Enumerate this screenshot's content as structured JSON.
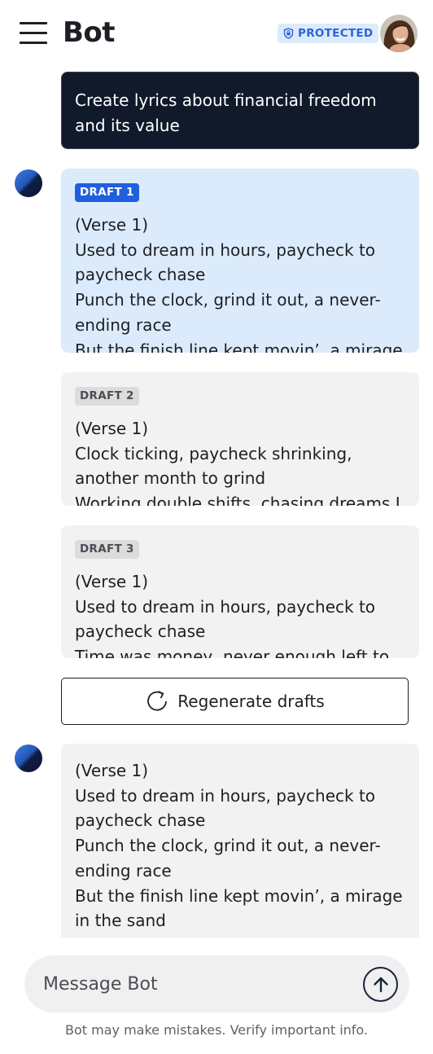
{
  "header": {
    "title": "Bot",
    "badge": "PROTECTED"
  },
  "user_message": "Create lyrics about financial freedom and its value",
  "drafts": [
    {
      "label": "DRAFT 1",
      "text": "(Verse 1)\nUsed to dream in hours, paycheck to paycheck chase\nPunch the clock, grind it out, a never-ending race\nBut the finish line kept movin’, a mirage in",
      "selected": true
    },
    {
      "label": "DRAFT 2",
      "text": "(Verse 1)\nClock ticking, paycheck shrinking, another month to grind\nWorking double shifts, chasing dreams I",
      "selected": false
    },
    {
      "label": "DRAFT 3",
      "text": "(Verse 1)\nUsed to dream in hours, paycheck to paycheck chase\nTime was money, never enough left to",
      "selected": false
    }
  ],
  "regenerate_label": "Regenerate drafts",
  "reply_text": "(Verse 1)\nUsed to dream in hours, paycheck to paycheck chase\nPunch the clock, grind it out, a never-ending race\nBut the finish line kept movin’, a mirage in the sand",
  "composer": {
    "placeholder": "Message Bot"
  },
  "disclaimer": "Bot may make mistakes. Verify important info.",
  "icons": {
    "menu": "hamburger-menu-icon",
    "shield": "shield-icon",
    "regenerate": "refresh-icon",
    "send": "arrow-up-icon"
  },
  "colors": {
    "accent": "#1f5fe0",
    "user_bubble": "#111a2b",
    "selected_draft": "#dcebfb",
    "draft_bg": "#f2f2f2",
    "badge_text": "#2b63d9"
  }
}
